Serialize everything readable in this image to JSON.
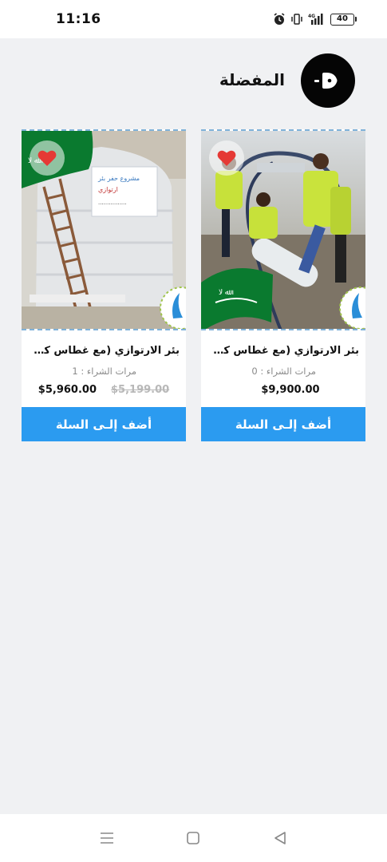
{
  "status": {
    "time": "11:16",
    "battery": "40",
    "icons": [
      "alarm-icon",
      "vibrate-icon",
      "signal-icon"
    ]
  },
  "header": {
    "title": "المفضلة",
    "avatar_icon": "play-logo-icon"
  },
  "products": [
    {
      "title": "بئر الارتوازي (مع غطاس كهربا...",
      "purchases": "مرات الشراء : 0",
      "price": "$9,900.00",
      "old_price": "",
      "favorite": true,
      "add_label": "أضف إلـى السلة"
    },
    {
      "title": "بئر الارتوازي (مع غطاس كهربا...",
      "purchases": "مرات الشراء : 1",
      "price": "$5,960.00",
      "old_price": "$5,199.00",
      "favorite": true,
      "add_label": "أضف إلـى السلة"
    }
  ],
  "navbar": {
    "icons": [
      "menu-icon",
      "home-square-icon",
      "back-triangle-icon"
    ]
  },
  "colors": {
    "accent": "#2b9bf0",
    "heart": "#e53935",
    "flag_green": "#0a7a2f"
  }
}
